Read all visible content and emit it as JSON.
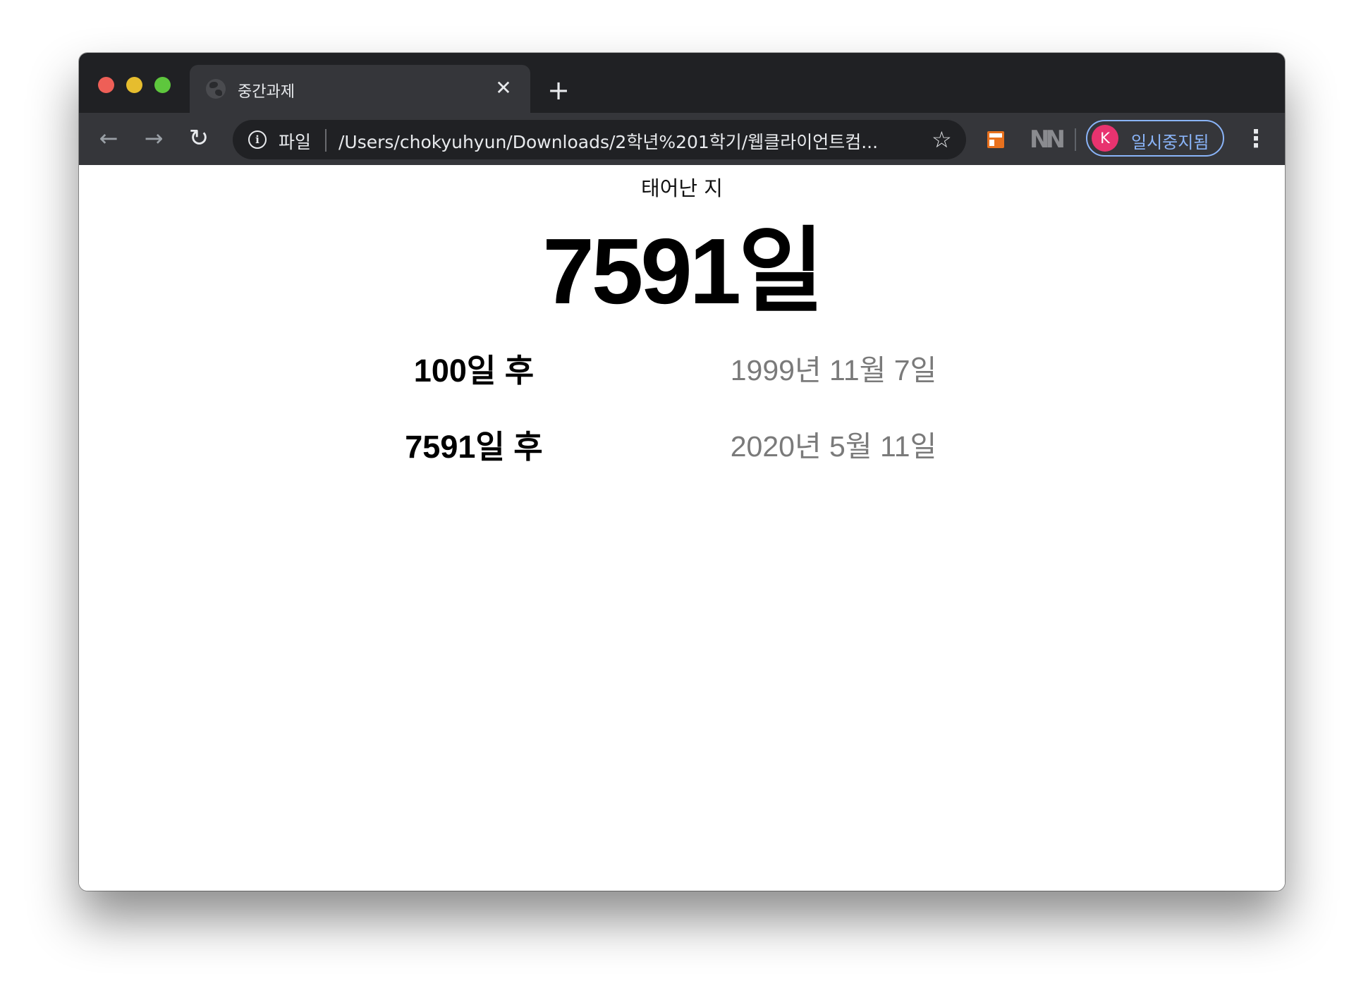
{
  "browser": {
    "tab": {
      "title": "중간과제",
      "close_glyph": "✕"
    },
    "new_tab_glyph": "+",
    "nav": {
      "back_glyph": "←",
      "forward_glyph": "→",
      "reload_glyph": "↻"
    },
    "omnibox": {
      "scheme_label": "파일",
      "url": "/Users/chokyuhyun/Downloads/2학년%201학기/웹클라이언트컴...",
      "star_glyph": "☆"
    },
    "extensions": {
      "ext2_label": "NN"
    },
    "profile": {
      "avatar_letter": "K",
      "status_label": "일시중지됨"
    },
    "menu_glyph": "⋮"
  },
  "page": {
    "subtitle": "태어난 지",
    "days_since_birth": "7591일",
    "rows": [
      {
        "label": "100일 후",
        "date": "1999년 11월 7일"
      },
      {
        "label": "7591일 후",
        "date": "2020년 5월 11일"
      }
    ]
  }
}
